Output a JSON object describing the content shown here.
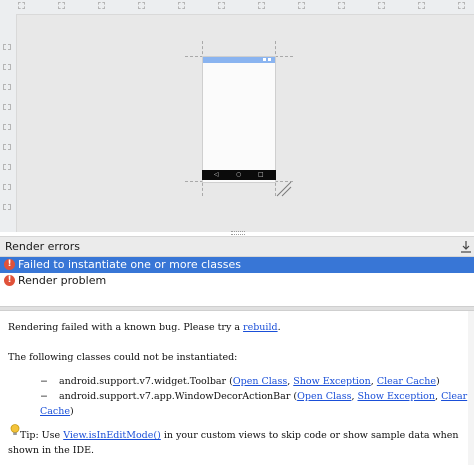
{
  "panel": {
    "title": "Render errors"
  },
  "errors": [
    {
      "label": "Failed to instantiate one or more classes",
      "selected": true
    },
    {
      "label": "Render problem",
      "selected": false
    }
  ],
  "details": {
    "line1_prefix": "Rendering failed with a known bug. Please try a ",
    "line1_link": "rebuild",
    "line1_suffix": ".",
    "line2": "The following classes could not be instantiated:",
    "classes": [
      {
        "bullet": "−",
        "name": "android.support.v7.widget.Toolbar (",
        "open": "Open Class",
        "sep1": ", ",
        "show": "Show Exception",
        "sep2": ", ",
        "clear": "Clear Cache",
        "end": ")"
      },
      {
        "bullet": "−",
        "name": "android.support.v7.app.WindowDecorActionBar (",
        "open": "Open Class",
        "sep1": ", ",
        "show": "Show Exception",
        "sep2": ", ",
        "clear_part1": "Clear",
        "clear_part2": "Cache",
        "end": ")"
      }
    ],
    "tip_prefix": "Tip: Use ",
    "tip_link": "View.isInEditMode()",
    "tip_suffix": " in your custom views to skip code or show sample data when",
    "tip_line2": "shown in the IDE."
  },
  "phone": {
    "nav_back": "◁",
    "nav_home": "○",
    "nav_recent": "□"
  },
  "icons": {
    "error": "error-icon",
    "export": "export-icon",
    "tip": "lightbulb-icon",
    "resize": "resize-handle-icon"
  },
  "colors": {
    "selection": "#3876d6",
    "link": "#1a4fd8",
    "error": "#e0523a",
    "status_bar": "#8ab4f0"
  }
}
